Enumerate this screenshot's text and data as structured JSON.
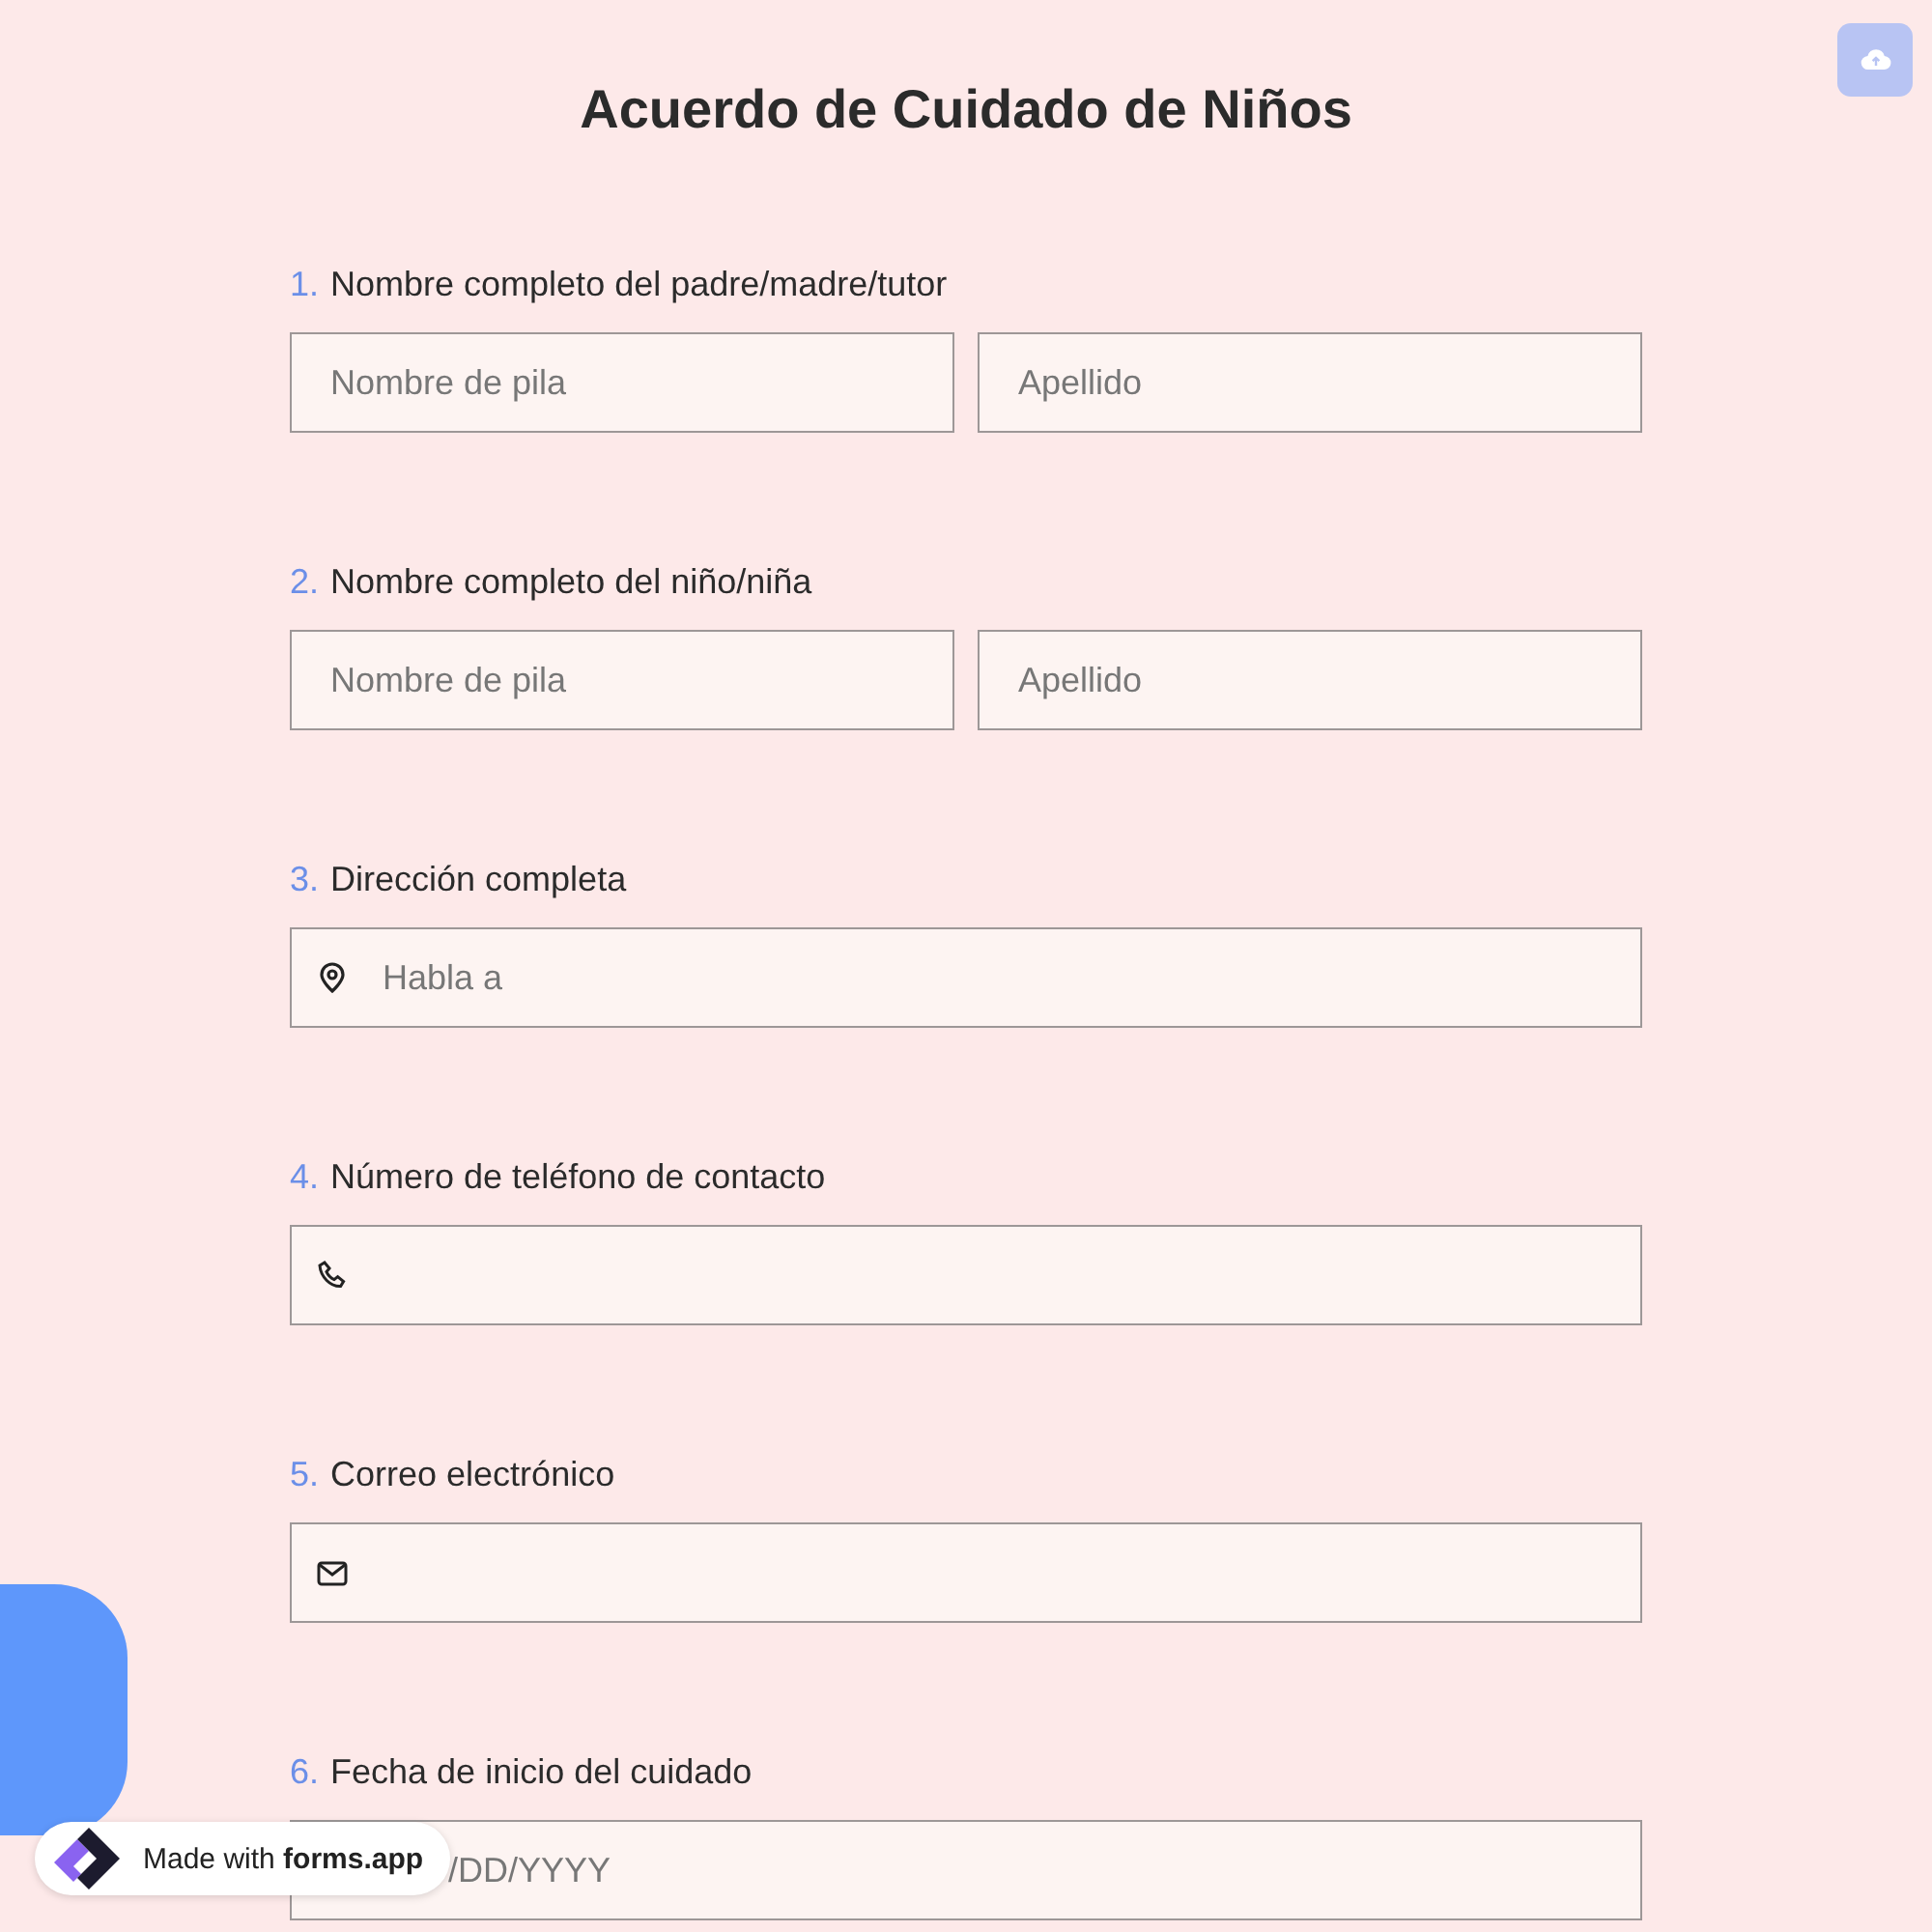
{
  "title": "Acuerdo de Cuidado de Niños",
  "questions": [
    {
      "number": "1.",
      "label": "Nombre completo del padre/madre/tutor",
      "kind": "name",
      "fields": [
        {
          "placeholder": "Nombre de pila"
        },
        {
          "placeholder": "Apellido"
        }
      ]
    },
    {
      "number": "2.",
      "label": "Nombre completo del niño/niña",
      "kind": "name",
      "fields": [
        {
          "placeholder": "Nombre de pila"
        },
        {
          "placeholder": "Apellido"
        }
      ]
    },
    {
      "number": "3.",
      "label": "Dirección completa",
      "kind": "address",
      "fields": [
        {
          "placeholder": "Habla a"
        }
      ]
    },
    {
      "number": "4.",
      "label": "Número de teléfono de contacto",
      "kind": "phone"
    },
    {
      "number": "5.",
      "label": "Correo electrónico",
      "kind": "email"
    },
    {
      "number": "6.",
      "label": "Fecha de inicio del cuidado",
      "kind": "date",
      "fields": [
        {
          "placeholder": "/DD/YYYY"
        }
      ]
    }
  ],
  "badge": {
    "text": "Made with **forms.app**"
  }
}
